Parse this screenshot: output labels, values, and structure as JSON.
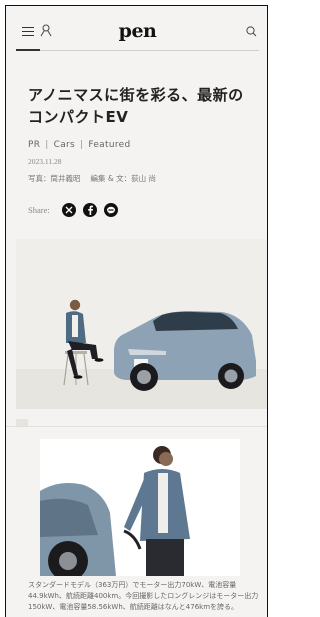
{
  "header": {
    "logo": "pen",
    "menu_icon": "hamburger-menu-icon",
    "user_icon": "user-icon",
    "search_icon": "search-icon"
  },
  "article": {
    "title": "アノニマスに街を彩る、最新のコンパクトEV",
    "tags": [
      "PR",
      "Cars",
      "Featured"
    ],
    "date": "2023.11.28",
    "photo_credit": "写真：筒井義昭",
    "edit_credit": "編集 & 文：荻山 尚",
    "share_label": "Share:",
    "share_icons": [
      "x-icon",
      "facebook-icon",
      "line-icon"
    ],
    "caption": "スタンダードモデル（363万円）でモーター出力70kW、電池容量44.9kWh、航続距離400km。今回撮影したロングレンジはモーター出力150kW、電池容量58.56kWh、航続距離はなんと476kmを誇る。"
  },
  "colors": {
    "page_bg": "#f4f3f1",
    "text": "#222222",
    "car_blue": "#8da3b5"
  }
}
